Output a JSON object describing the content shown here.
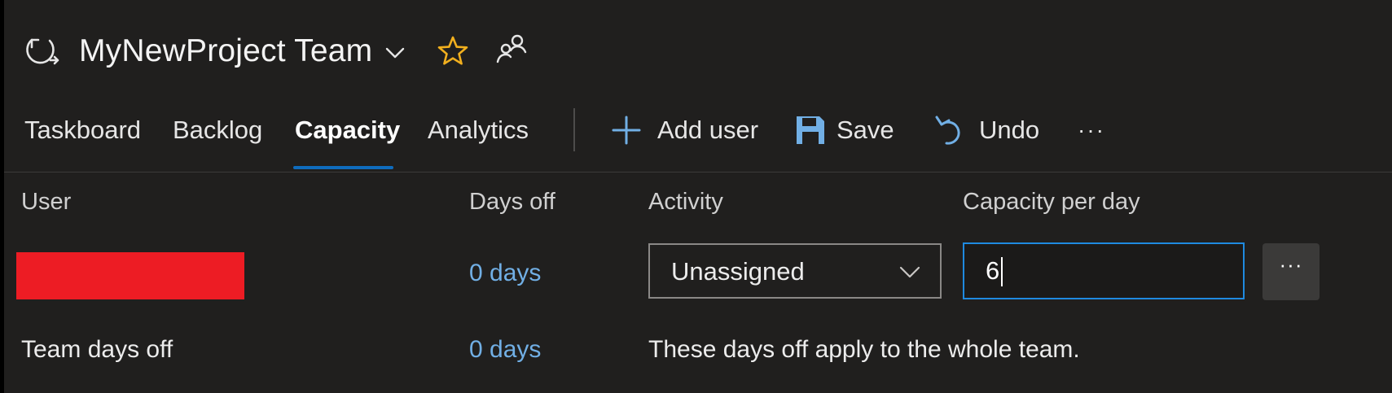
{
  "header": {
    "team_name": "MyNewProject Team",
    "icons": {
      "sprint": "sprint-cycle-icon",
      "dropdown": "chevron-down-icon",
      "favorite": "star-icon",
      "team_members": "people-icon"
    },
    "favorite_color": "#f2b01e"
  },
  "tabs": [
    {
      "label": "Taskboard",
      "active": false
    },
    {
      "label": "Backlog",
      "active": false
    },
    {
      "label": "Capacity",
      "active": true
    },
    {
      "label": "Analytics",
      "active": false
    }
  ],
  "toolbar": {
    "add_user_label": "Add user",
    "save_label": "Save",
    "undo_label": "Undo",
    "more_label": "···",
    "icons": {
      "add_user": "plus-icon",
      "save": "save-disk-icon",
      "undo": "undo-icon",
      "more": "more-horizontal-icon"
    },
    "accent_color": "#71afe5"
  },
  "grid": {
    "columns": {
      "user": "User",
      "days_off": "Days off",
      "activity": "Activity",
      "capacity_per_day": "Capacity per day"
    },
    "rows": [
      {
        "user": "[redacted]",
        "days_off": "0 days",
        "activity": "Unassigned",
        "capacity_per_day": "6",
        "more_label": "···"
      }
    ],
    "team_row": {
      "label": "Team days off",
      "days_off": "0 days",
      "note": "These days off apply to the whole team."
    }
  },
  "colors": {
    "background": "#201f1e",
    "active_tab_underline": "#0f6cbd",
    "link": "#71afe5",
    "redaction": "#ed1c24",
    "input_focus_border": "#1f8ae0"
  }
}
